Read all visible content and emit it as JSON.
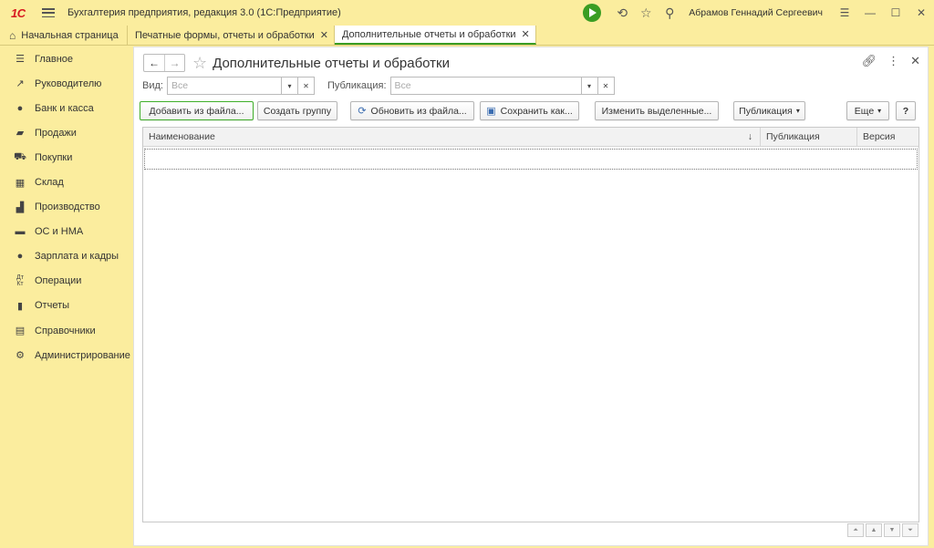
{
  "app": {
    "logo": "1С",
    "title": "Бухгалтерия предприятия, редакция 3.0  (1С:Предприятие)",
    "user": "Абрамов Геннадий Сергеевич"
  },
  "tabs": [
    {
      "label": "Начальная страница"
    },
    {
      "label": "Печатные формы, отчеты и обработки"
    },
    {
      "label": "Дополнительные отчеты и обработки"
    }
  ],
  "sidebar": {
    "items": [
      {
        "label": "Главное",
        "icon": "menu-lines-icon"
      },
      {
        "label": "Руководителю",
        "icon": "trend-icon"
      },
      {
        "label": "Банк и касса",
        "icon": "coin-icon"
      },
      {
        "label": "Продажи",
        "icon": "bag-icon"
      },
      {
        "label": "Покупки",
        "icon": "cart-icon"
      },
      {
        "label": "Склад",
        "icon": "warehouse-icon"
      },
      {
        "label": "Производство",
        "icon": "factory-icon"
      },
      {
        "label": "ОС и НМА",
        "icon": "truck-icon"
      },
      {
        "label": "Зарплата и кадры",
        "icon": "person-icon"
      },
      {
        "label": "Операции",
        "icon": "dt-kt-icon"
      },
      {
        "label": "Отчеты",
        "icon": "bar-chart-icon"
      },
      {
        "label": "Справочники",
        "icon": "books-icon"
      },
      {
        "label": "Администрирование",
        "icon": "gear-icon"
      }
    ]
  },
  "page": {
    "title": "Дополнительные отчеты и обработки"
  },
  "filters": {
    "vid_label": "Вид:",
    "vid_placeholder": "Все",
    "publication_label": "Публикация:",
    "publication_placeholder": "Все"
  },
  "toolbar": {
    "add_from_file": "Добавить из файла...",
    "create_group": "Создать группу",
    "update_from_file": "Обновить из файла...",
    "save_as": "Сохранить как...",
    "edit_selected": "Изменить выделенные...",
    "publication": "Публикация",
    "more": "Еще",
    "help": "?"
  },
  "table": {
    "columns": [
      "Наименование",
      "Публикация",
      "Версия"
    ],
    "rows": []
  }
}
